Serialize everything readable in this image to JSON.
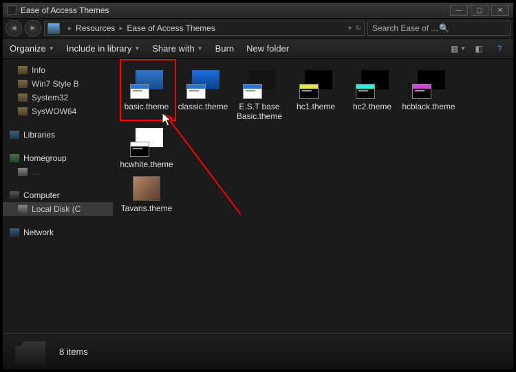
{
  "window": {
    "title": "Ease of Access Themes"
  },
  "breadcrumb": {
    "items": [
      "Resources",
      "Ease of Access Themes"
    ]
  },
  "search": {
    "placeholder": "Search Ease of Access T…"
  },
  "toolbar": {
    "organize": "Organize",
    "include": "Include in library",
    "share": "Share with",
    "burn": "Burn",
    "newfolder": "New folder"
  },
  "sidebar": {
    "quick": [
      {
        "label": "Info"
      },
      {
        "label": "Win7 Style B"
      },
      {
        "label": "System32"
      },
      {
        "label": "SysWOW64"
      }
    ],
    "groups": [
      {
        "label": "Libraries",
        "icon": "lib"
      },
      {
        "label": "Homegroup",
        "icon": "home"
      },
      {
        "label": "Computer",
        "icon": "comp",
        "children": [
          {
            "label": "Local Disk (C",
            "selected": true
          }
        ]
      },
      {
        "label": "Network",
        "icon": "net"
      }
    ]
  },
  "files": [
    {
      "label": "basic.theme",
      "thumb": "blue",
      "highlight": true
    },
    {
      "label": "classic.theme",
      "thumb": "blue2"
    },
    {
      "label": "E.S.T base Basic.theme",
      "thumb": "dark"
    },
    {
      "label": "hc1.theme",
      "thumb": "hc1"
    },
    {
      "label": "hc2.theme",
      "thumb": "hc2"
    },
    {
      "label": "hcblack.theme",
      "thumb": "hcb"
    },
    {
      "label": "hcwhite.theme",
      "thumb": "hcw"
    },
    {
      "label": "Tavaris.theme",
      "thumb": "photo"
    }
  ],
  "status": {
    "text": "8 items"
  }
}
